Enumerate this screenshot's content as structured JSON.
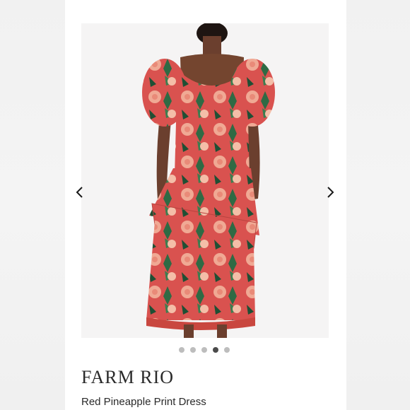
{
  "brand": "FARM RIO",
  "product_name": "Red Pineapple Print Dress",
  "carousel": {
    "slide_count": 5,
    "active_index": 3,
    "prev_icon": "chevron-left-icon",
    "next_icon": "chevron-right-icon"
  },
  "colors": {
    "dress_base": "#d9524f",
    "dress_pink": "#f0a994",
    "leaf_green": "#2f6a44",
    "active_dot": "#4a4a4a",
    "inactive_dot": "#bdbdbd"
  }
}
